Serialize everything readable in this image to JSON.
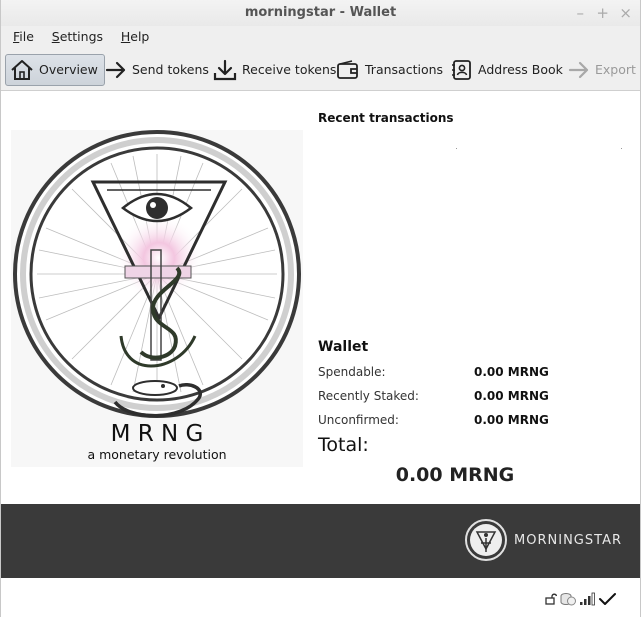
{
  "window": {
    "title": "morningstar - Wallet",
    "controls": {
      "minimize": "–",
      "maximize": "+",
      "close": "×"
    }
  },
  "menu": {
    "file": "File",
    "settings": "Settings",
    "help": "Help"
  },
  "toolbar": {
    "overview": "Overview",
    "send": "Send tokens",
    "receive": "Receive tokens",
    "transactions": "Transactions",
    "address_book": "Address Book",
    "export": "Export"
  },
  "logo": {
    "brand": "M R N G",
    "tagline": "a monetary revolution"
  },
  "recent": {
    "title": "Recent transactions"
  },
  "wallet": {
    "title": "Wallet",
    "spendable_label": "Spendable:",
    "spendable_value": "0.00 MRNG",
    "staked_label": "Recently Staked:",
    "staked_value": "0.00 MRNG",
    "unconfirmed_label": "Unconfirmed:",
    "unconfirmed_value": "0.00 MRNG",
    "total_label": "Total:",
    "total_value": "0.00 MRNG"
  },
  "footer": {
    "brand_text": "MORNINGSTAR"
  },
  "status": {
    "icons": [
      "lock-icon",
      "staking-icon",
      "signal-icon",
      "sync-check-icon"
    ]
  },
  "colors": {
    "footer_bg": "#3a3a3a",
    "toolbar_bg": "#efefef",
    "active_border": "#9aa2ab"
  }
}
